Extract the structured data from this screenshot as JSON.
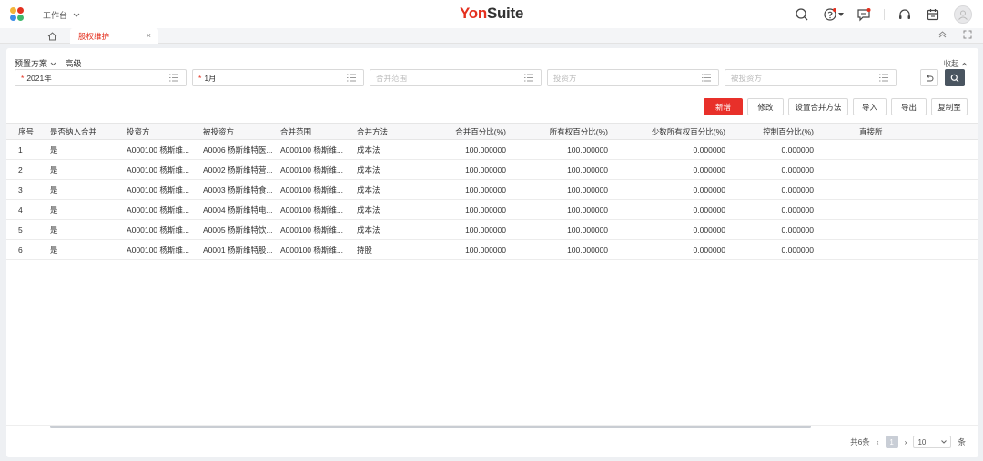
{
  "header": {
    "workbench_label": "工作台",
    "brand_prefix": "Yon",
    "brand_suffix": "Suite",
    "icons": [
      "search-icon",
      "help-icon",
      "message-icon",
      "headset-icon",
      "calendar-icon",
      "avatar"
    ]
  },
  "tabs": {
    "home_icon": "home-icon",
    "active_label": "股权维护",
    "close_glyph": "×"
  },
  "filter": {
    "scheme_label": "预置方案",
    "advanced_label": "高级",
    "collapse_label": "收起",
    "fields": [
      {
        "value": "2021年",
        "required": true
      },
      {
        "value": "1月",
        "required": true
      },
      {
        "placeholder": "合并范围"
      },
      {
        "placeholder": "投资方"
      },
      {
        "placeholder": "被投资方"
      }
    ]
  },
  "actions": {
    "add": "新增",
    "edit": "修改",
    "set_method": "设置合并方法",
    "import": "导入",
    "export": "导出",
    "copy_to": "复制至"
  },
  "table": {
    "columns": [
      "序号",
      "是否纳入合并",
      "投资方",
      "被投资方",
      "合并范围",
      "合并方法",
      "合并百分比(%)",
      "所有权百分比(%)",
      "少数所有权百分比(%)",
      "控制百分比(%)",
      "直接所"
    ],
    "rows": [
      [
        "1",
        "是",
        "A000100 杨斯维...",
        "A0006 杨斯维特医...",
        "A000100 杨斯维...",
        "成本法",
        "100.000000",
        "100.000000",
        "0.000000",
        "0.000000",
        ""
      ],
      [
        "2",
        "是",
        "A000100 杨斯维...",
        "A0002 杨斯维特营...",
        "A000100 杨斯维...",
        "成本法",
        "100.000000",
        "100.000000",
        "0.000000",
        "0.000000",
        ""
      ],
      [
        "3",
        "是",
        "A000100 杨斯维...",
        "A0003 杨斯维特食...",
        "A000100 杨斯维...",
        "成本法",
        "100.000000",
        "100.000000",
        "0.000000",
        "0.000000",
        ""
      ],
      [
        "4",
        "是",
        "A000100 杨斯维...",
        "A0004 杨斯维特电...",
        "A000100 杨斯维...",
        "成本法",
        "100.000000",
        "100.000000",
        "0.000000",
        "0.000000",
        ""
      ],
      [
        "5",
        "是",
        "A000100 杨斯维...",
        "A0005 杨斯维特饮...",
        "A000100 杨斯维...",
        "成本法",
        "100.000000",
        "100.000000",
        "0.000000",
        "0.000000",
        ""
      ],
      [
        "6",
        "是",
        "A000100 杨斯维...",
        "A0001 杨斯维特股...",
        "A000100 杨斯维...",
        "持股",
        "100.000000",
        "100.000000",
        "0.000000",
        "0.000000",
        ""
      ]
    ]
  },
  "pager": {
    "total": "共6条",
    "prev": "‹",
    "current": "1",
    "next": "›",
    "page_size": "10",
    "unit": "条"
  },
  "colors": {
    "accent": "#e4301f",
    "primary_button": "#e8302a",
    "search_button": "#4a5560"
  }
}
